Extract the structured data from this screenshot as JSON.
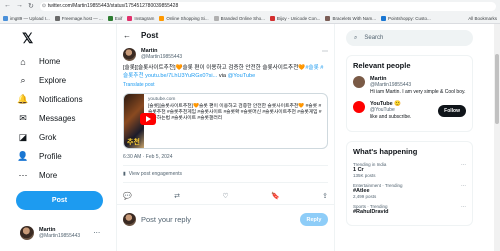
{
  "browser": {
    "url": "twitter.com/Martin19855443/status/1754512780039855428",
    "bookmarks": [
      {
        "label": "img89 — Upload I...",
        "color": "#4a90d9"
      },
      {
        "label": "Freemage.host — ...",
        "color": "#6a6a6a"
      },
      {
        "label": "Exif",
        "color": "#2e7d32"
      },
      {
        "label": "Instagram",
        "color": "#e1306c"
      },
      {
        "label": "Online Shopping Si...",
        "color": "#ff9900"
      },
      {
        "label": "Branded Online Sho...",
        "color": "#b0b0b0"
      },
      {
        "label": "Bijoy - Unicode Con...",
        "color": "#d32f2f"
      },
      {
        "label": "Bracelets With Nam...",
        "color": "#7b5e57"
      },
      {
        "label": "Pointshoppy: Custo...",
        "color": "#1976d2"
      }
    ],
    "all_bookmarks": "All Bookmarks"
  },
  "nav": {
    "items": [
      {
        "label": "Home",
        "icon": "⌂"
      },
      {
        "label": "Explore",
        "icon": "⌕"
      },
      {
        "label": "Notifications",
        "icon": "🔔"
      },
      {
        "label": "Messages",
        "icon": "✉"
      },
      {
        "label": "Grok",
        "icon": "◪"
      },
      {
        "label": "Profile",
        "icon": "👤"
      },
      {
        "label": "More",
        "icon": "⋯"
      }
    ],
    "post_button": "Post",
    "profile": {
      "name": "Martin",
      "handle": "@Martin19855443"
    }
  },
  "main": {
    "title": "Post",
    "tweet": {
      "name": "Martin",
      "handle": "@Martin19855443",
      "text_plain_1": "[슬롯][슬롯사이트추천]🧡슬롯 편이 이용하고 검증한 안전한 슬롯사이트추천🧡",
      "text_link_1": "#슬롯 #슬롯추천 youtu.be/7LhU3YuRGx0?si...",
      "text_via": " via ",
      "text_link_2": "@YouTube",
      "translate": "Translate post",
      "card": {
        "domain": "youtube.com",
        "text": "[슬롯][슬롯사이트추천]🧡슬롯 편이 이용하고 검증한 안전한 슬롯사이트추천🧡 #슬롯 #슬롯추천 #슬롯추천게임 #슬롯사이트 #슬롯확 #슬롯머신 #슬롯사이트추천 #슬롯게임 #슬롯하는법 #슬롯사이트 #슬롯갤러리",
        "thumb_text": "추천"
      },
      "meta": "6:30 AM · Feb 5, 2024",
      "engagements": "View post engagements"
    },
    "reply_placeholder": "Post your reply",
    "reply_button": "Reply"
  },
  "sidebar": {
    "search_placeholder": "Search",
    "relevant_title": "Relevant people",
    "people": [
      {
        "name": "Martin",
        "handle": "@Martin19855443",
        "bio": "Hi iam Martin. I am very simple & Cool boy.",
        "color": "#7a5a46"
      },
      {
        "name": "YouTube 🙂",
        "handle": "@YouTube",
        "bio": "like and subscribe.",
        "follow": "Follow",
        "color": "#ff0000"
      }
    ],
    "happening_title": "What's happening",
    "trends": [
      {
        "category": "Trending in India",
        "title": "1 Cr",
        "count": "135K posts"
      },
      {
        "category": "Entertainment · Trending",
        "title": "#Atlee",
        "count": "2,499 posts"
      },
      {
        "category": "Sports · Trending",
        "title": "#RahulDravid",
        "count": ""
      }
    ]
  }
}
